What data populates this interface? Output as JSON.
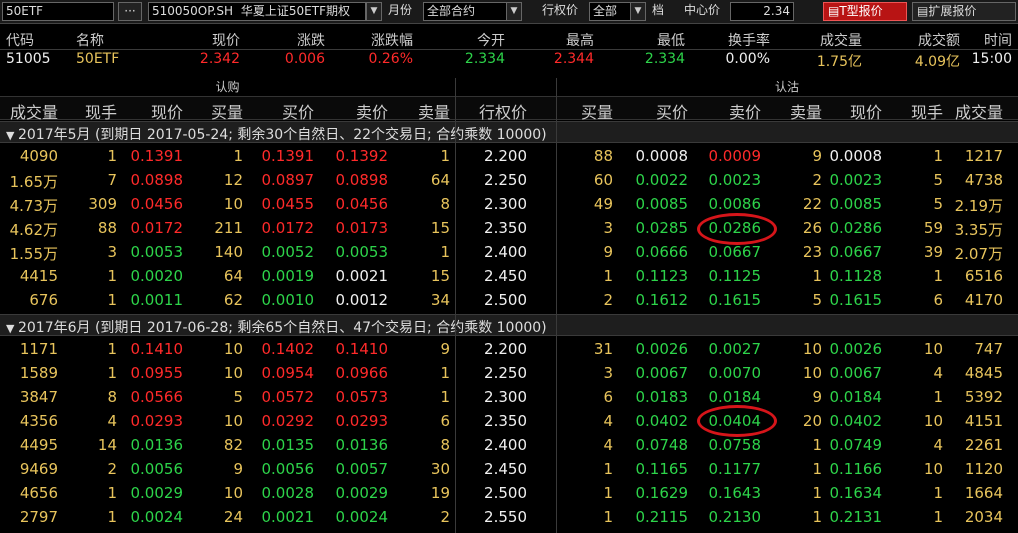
{
  "toolbar": {
    "symbol": "50ETF",
    "more": "···",
    "contract_code": "510050OP.SH",
    "contract_name": "华夏上证50ETF期权",
    "month_label": "月份",
    "month_value": "全部合约",
    "strike_label": "行权价",
    "strike_value": "全部",
    "step_label": "档",
    "center_label": "中心价",
    "center_value": "2.34",
    "t_quote_btn": "T型报价",
    "ext_quote_btn": "扩展报价"
  },
  "quote": {
    "headers": [
      "代码",
      "名称",
      "现价",
      "涨跌",
      "涨跌幅",
      "今开",
      "最高",
      "最低",
      "换手率",
      "成交量",
      "成交额",
      "时间"
    ],
    "values": [
      "51005",
      "50ETF",
      "2.342",
      "0.006",
      "0.26%",
      "2.334",
      "2.344",
      "2.334",
      "0.00%",
      "1.75亿",
      "4.09亿",
      "15:00"
    ]
  },
  "groups": {
    "call": "认购",
    "put": "认沽"
  },
  "columns": {
    "call": [
      "成交量",
      "现手",
      "现价",
      "买量",
      "买价",
      "卖价",
      "卖量"
    ],
    "strike": "行权价",
    "put": [
      "买量",
      "买价",
      "卖价",
      "卖量",
      "现价",
      "现手",
      "成交量"
    ]
  },
  "sections": [
    {
      "title": "2017年5月 (到期日 2017-05-24; 剩余30个自然日、22个交易日; 合约乘数 10000)",
      "rows": [
        {
          "call": [
            "4090",
            "1",
            "0.1391",
            "1",
            "0.1391",
            "0.1392",
            "1"
          ],
          "strike": "2.200",
          "put": [
            "88",
            "0.0008",
            "0.0009",
            "9",
            "0.0008",
            "1",
            "1217"
          ]
        },
        {
          "call": [
            "1.65万",
            "7",
            "0.0898",
            "12",
            "0.0897",
            "0.0898",
            "64"
          ],
          "strike": "2.250",
          "put": [
            "60",
            "0.0022",
            "0.0023",
            "2",
            "0.0023",
            "5",
            "4738"
          ]
        },
        {
          "call": [
            "4.73万",
            "309",
            "0.0456",
            "10",
            "0.0455",
            "0.0456",
            "8"
          ],
          "strike": "2.300",
          "put": [
            "49",
            "0.0085",
            "0.0086",
            "22",
            "0.0085",
            "5",
            "2.19万"
          ]
        },
        {
          "call": [
            "4.62万",
            "88",
            "0.0172",
            "211",
            "0.0172",
            "0.0173",
            "15"
          ],
          "strike": "2.350",
          "put": [
            "3",
            "0.0285",
            "0.0286",
            "26",
            "0.0286",
            "59",
            "3.35万"
          ]
        },
        {
          "call": [
            "1.55万",
            "3",
            "0.0053",
            "140",
            "0.0052",
            "0.0053",
            "1"
          ],
          "strike": "2.400",
          "put": [
            "9",
            "0.0666",
            "0.0667",
            "23",
            "0.0667",
            "39",
            "2.07万"
          ]
        },
        {
          "call": [
            "4415",
            "1",
            "0.0020",
            "64",
            "0.0019",
            "0.0021",
            "15"
          ],
          "strike": "2.450",
          "put": [
            "1",
            "0.1123",
            "0.1125",
            "1",
            "0.1128",
            "1",
            "6516"
          ]
        },
        {
          "call": [
            "676",
            "1",
            "0.0011",
            "62",
            "0.0010",
            "0.0012",
            "34"
          ],
          "strike": "2.500",
          "put": [
            "2",
            "0.1612",
            "0.1615",
            "5",
            "0.1615",
            "6",
            "4170"
          ]
        }
      ]
    },
    {
      "title": "2017年6月 (到期日 2017-06-28; 剩余65个自然日、47个交易日; 合约乘数 10000)",
      "rows": [
        {
          "call": [
            "1171",
            "1",
            "0.1410",
            "10",
            "0.1402",
            "0.1410",
            "9"
          ],
          "strike": "2.200",
          "put": [
            "31",
            "0.0026",
            "0.0027",
            "10",
            "0.0026",
            "10",
            "747"
          ]
        },
        {
          "call": [
            "1589",
            "1",
            "0.0955",
            "10",
            "0.0954",
            "0.0966",
            "1"
          ],
          "strike": "2.250",
          "put": [
            "3",
            "0.0067",
            "0.0070",
            "10",
            "0.0067",
            "4",
            "4845"
          ]
        },
        {
          "call": [
            "3847",
            "8",
            "0.0566",
            "5",
            "0.0572",
            "0.0573",
            "1"
          ],
          "strike": "2.300",
          "put": [
            "6",
            "0.0183",
            "0.0184",
            "9",
            "0.0184",
            "1",
            "5392"
          ]
        },
        {
          "call": [
            "4356",
            "4",
            "0.0293",
            "10",
            "0.0292",
            "0.0293",
            "6"
          ],
          "strike": "2.350",
          "put": [
            "4",
            "0.0402",
            "0.0404",
            "20",
            "0.0402",
            "10",
            "4151"
          ]
        },
        {
          "call": [
            "4495",
            "14",
            "0.0136",
            "82",
            "0.0135",
            "0.0136",
            "8"
          ],
          "strike": "2.400",
          "put": [
            "4",
            "0.0748",
            "0.0758",
            "1",
            "0.0749",
            "4",
            "2261"
          ]
        },
        {
          "call": [
            "9469",
            "2",
            "0.0056",
            "9",
            "0.0056",
            "0.0057",
            "30"
          ],
          "strike": "2.450",
          "put": [
            "1",
            "0.1165",
            "0.1177",
            "1",
            "0.1166",
            "10",
            "1120"
          ]
        },
        {
          "call": [
            "4656",
            "1",
            "0.0029",
            "10",
            "0.0028",
            "0.0029",
            "19"
          ],
          "strike": "2.500",
          "put": [
            "1",
            "0.1629",
            "0.1643",
            "1",
            "0.1634",
            "1",
            "1664"
          ]
        },
        {
          "call": [
            "2797",
            "1",
            "0.0024",
            "24",
            "0.0021",
            "0.0024",
            "2"
          ],
          "strike": "2.550",
          "put": [
            "1",
            "0.2115",
            "0.2130",
            "1",
            "0.2131",
            "1",
            "2034"
          ]
        }
      ]
    }
  ]
}
